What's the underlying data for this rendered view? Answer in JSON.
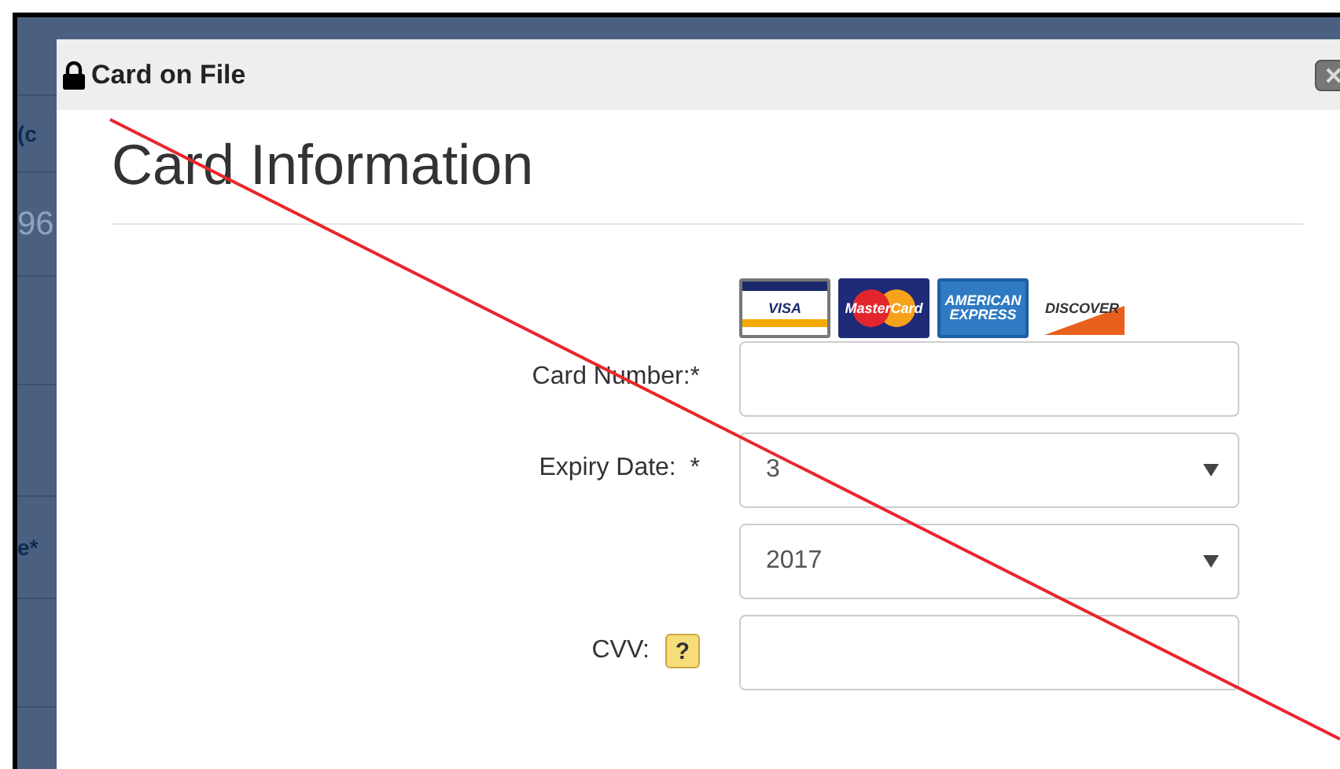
{
  "background": {
    "fragments": [
      "(c",
      "96",
      "e*"
    ]
  },
  "dialog": {
    "title": "Card on File",
    "heading": "Card Information",
    "card_logos": [
      {
        "kind": "visa",
        "label": "VISA"
      },
      {
        "kind": "mastercard",
        "label": "MasterCard"
      },
      {
        "kind": "amex",
        "label": "AMERICAN EXPRESS"
      },
      {
        "kind": "discover",
        "label": "DISCOVER"
      }
    ],
    "fields": [
      {
        "kind": "text",
        "label": "Card Number:*"
      },
      {
        "kind": "select",
        "label": "Expiry Date:  *",
        "value": "3"
      },
      {
        "kind": "select",
        "value": "2017"
      },
      {
        "kind": "text",
        "label": "CVV:",
        "help": "?"
      }
    ]
  }
}
